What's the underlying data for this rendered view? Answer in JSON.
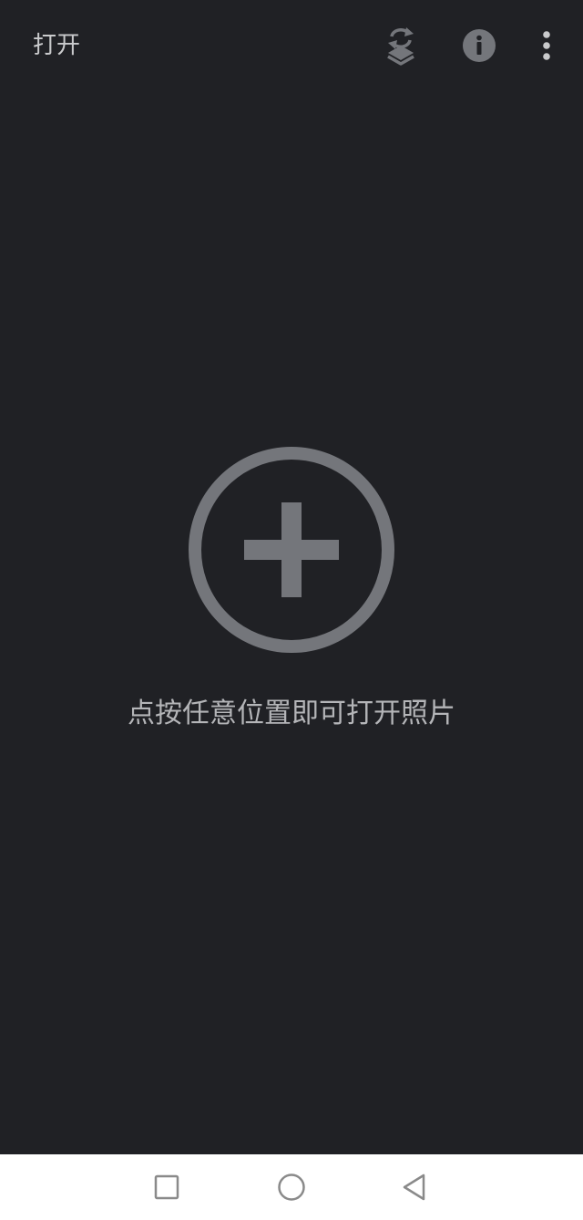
{
  "header": {
    "title": "打开",
    "icons": {
      "stack": "layers-swap-icon",
      "info": "info-icon",
      "more": "more-vert-icon"
    }
  },
  "main": {
    "add_icon": "add-circle-icon",
    "hint": "点按任意位置即可打开照片"
  },
  "system_nav": {
    "recent": "square-icon",
    "home": "circle-icon",
    "back": "triangle-back-icon"
  },
  "colors": {
    "background": "#202125",
    "icon": "#74767b",
    "title_text": "#c9cacc",
    "hint_text": "#b4b5b8",
    "nav_background": "#ffffff",
    "nav_icon": "#8a8a8a"
  }
}
